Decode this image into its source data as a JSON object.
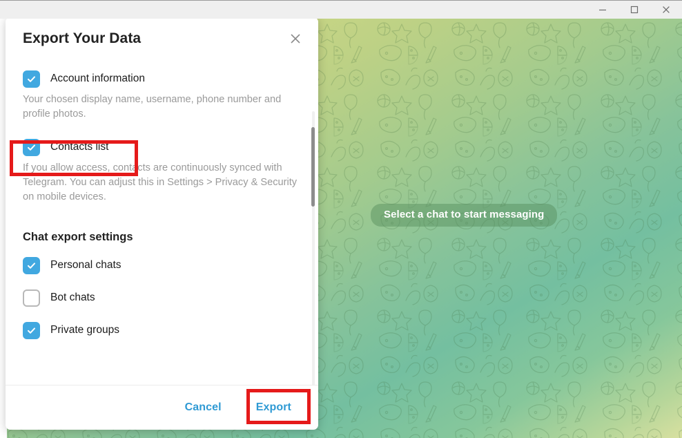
{
  "window": {
    "controls": [
      {
        "name": "minimize",
        "glyph": "minimize-icon"
      },
      {
        "name": "maximize",
        "glyph": "maximize-icon"
      },
      {
        "name": "close",
        "glyph": "close-icon"
      }
    ]
  },
  "chat": {
    "placeholder_pill": "Select a chat to start messaging",
    "background_gradient_from": "#d9de8e",
    "background_gradient_to": "#74bfa0"
  },
  "dialog": {
    "title": "Export Your Data",
    "close_icon": "close-icon",
    "options": [
      {
        "id": "account-information",
        "label": "Account information",
        "checked": true,
        "description": "Your chosen display name, username, phone number and profile photos."
      },
      {
        "id": "contacts-list",
        "label": "Contacts list",
        "checked": true,
        "description": "If you allow access, contacts are continuously synced with Telegram. You can adjust this in Settings > Privacy & Security on mobile devices.",
        "highlighted": true
      }
    ],
    "section": {
      "heading": "Chat export settings",
      "items": [
        {
          "id": "personal-chats",
          "label": "Personal chats",
          "checked": true
        },
        {
          "id": "bot-chats",
          "label": "Bot chats",
          "checked": false
        },
        {
          "id": "private-groups",
          "label": "Private groups",
          "checked": true
        }
      ]
    },
    "footer": {
      "cancel_label": "Cancel",
      "export_label": "Export",
      "export_highlighted": true
    },
    "accent_color": "#41a8e0",
    "link_color": "#2f9ad4",
    "highlight_color": "#e51a1a",
    "scrollbar_visible": true
  }
}
